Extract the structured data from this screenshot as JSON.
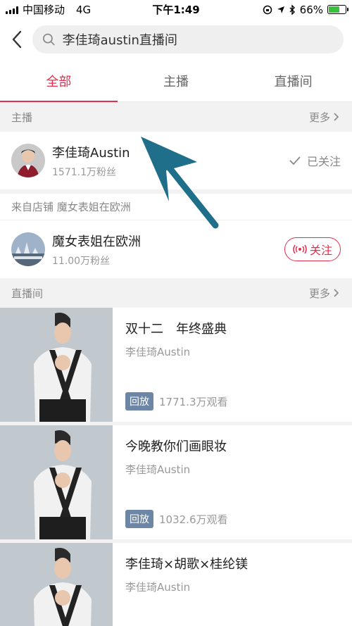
{
  "status_bar": {
    "carrier": "中国移动",
    "network": "4G",
    "time": "下午1:49",
    "battery_percent": "66%",
    "battery_level": 0.66
  },
  "search": {
    "back_icon": "chevron-left-icon",
    "query": "李佳琦austin直播间"
  },
  "tabs": [
    {
      "label": "全部",
      "active": true
    },
    {
      "label": "主播",
      "active": false
    },
    {
      "label": "直播间",
      "active": false
    }
  ],
  "anchors_section": {
    "title": "主播",
    "more_label": "更多",
    "anchor": {
      "name": "李佳琦Austin",
      "fans": "1571.1万粉丝",
      "follow_status": "已关注"
    }
  },
  "store_section": {
    "label": "来自店铺 魔女表姐在欧洲",
    "shop": {
      "name": "魔女表姐在欧洲",
      "fans": "11.00万粉丝",
      "follow_label": "关注"
    }
  },
  "live_section": {
    "title": "直播间",
    "more_label": "更多",
    "items": [
      {
        "title": "双十二　年终盛典",
        "author": "李佳琦Austin",
        "badge": "回放",
        "views": "1771.3万观看"
      },
      {
        "title": "今晚教你们画眼妆",
        "author": "李佳琦Austin",
        "badge": "回放",
        "views": "1032.6万观看"
      },
      {
        "title": "李佳琦×胡歌×桂纶镁",
        "author": "李佳琦Austin",
        "badge": "",
        "views": ""
      }
    ]
  },
  "colors": {
    "accent": "#e52e4d",
    "badge": "#6e86a6",
    "annotation_arrow": "#1f6f8b"
  }
}
